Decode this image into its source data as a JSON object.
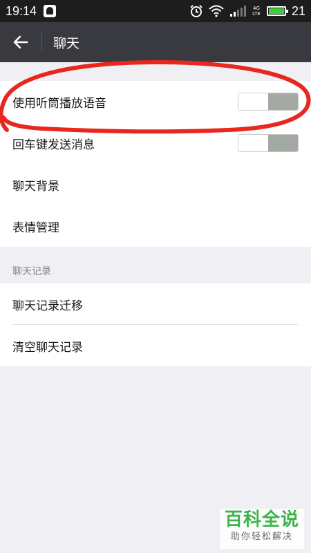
{
  "status_bar": {
    "time": "19:14",
    "battery_level": "21",
    "network_label": "4G LTE"
  },
  "app_bar": {
    "title": "聊天",
    "back_icon": "arrow-left-icon"
  },
  "settings": {
    "items": [
      {
        "label": "使用听筒播放语音",
        "toggle": true,
        "enabled": false
      },
      {
        "label": "回车键发送消息",
        "toggle": true,
        "enabled": false
      },
      {
        "label": "聊天背景",
        "toggle": false
      },
      {
        "label": "表情管理",
        "toggle": false
      }
    ]
  },
  "history_section": {
    "header": "聊天记录",
    "items": [
      {
        "label": "聊天记录迁移"
      },
      {
        "label": "清空聊天记录"
      }
    ]
  },
  "watermark": {
    "title": "百科全说",
    "subtitle": "助你轻松解决"
  },
  "colors": {
    "app_bar": "#393a3f",
    "status_bar": "#1d1d1d",
    "background": "#efeff4",
    "annotation": "#e8281f",
    "watermark_green": "#3cb44b"
  }
}
